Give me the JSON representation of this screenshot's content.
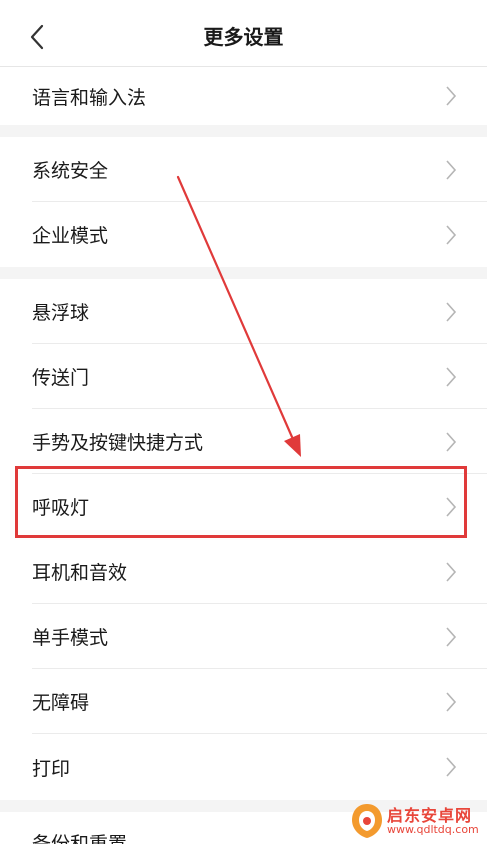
{
  "header": {
    "title": "更多设置",
    "back_icon": "chevron-left-icon"
  },
  "sections": [
    {
      "items": [
        {
          "label": "语言和输入法"
        }
      ]
    },
    {
      "items": [
        {
          "label": "系统安全"
        },
        {
          "label": "企业模式"
        }
      ]
    },
    {
      "items": [
        {
          "label": "悬浮球"
        },
        {
          "label": "传送门"
        },
        {
          "label": "手势及按键快捷方式"
        },
        {
          "label": "呼吸灯"
        },
        {
          "label": "耳机和音效"
        },
        {
          "label": "单手模式"
        },
        {
          "label": "无障碍"
        },
        {
          "label": "打印"
        }
      ]
    },
    {
      "items": [
        {
          "label": "备份和重置"
        }
      ]
    }
  ],
  "chevron_icon": "chevron-right-icon",
  "annotation": {
    "highlight_color": "#e03a3a",
    "arrow_color": "#e03a3a"
  },
  "watermark": {
    "line1": "启东安卓网",
    "line2": "www.qdltdq.com"
  }
}
